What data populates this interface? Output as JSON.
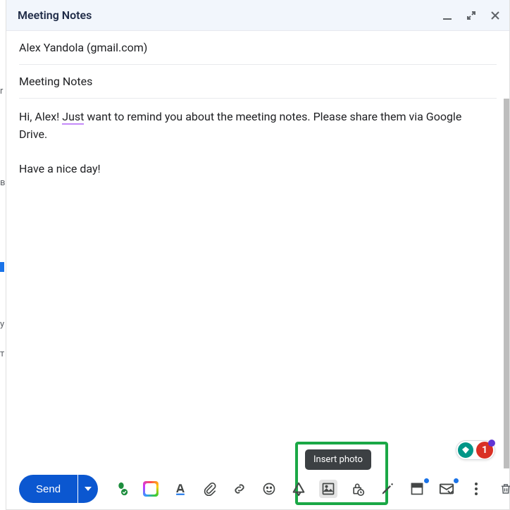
{
  "header": {
    "title": "Meeting Notes"
  },
  "fields": {
    "recipient": "Alex Yandola (gmail.com)",
    "subject": "Meeting Notes"
  },
  "body": {
    "greeting_prefix": "Hi, Alex! ",
    "underlined": "Just",
    "line1_rest": " want to remind you about the meeting notes. Please share them via Google Drive.",
    "line2": "Have a nice day!"
  },
  "toolbar": {
    "send_label": "Send",
    "tooltip": "Insert photo"
  },
  "extension": {
    "count": "1"
  },
  "icons": {
    "minimize": "minimize-icon",
    "expand": "expand-icon",
    "close": "close-icon",
    "send_more": "chevron-down-icon",
    "signature_check": "signature-check-icon",
    "ai_suggest": "ai-suggest-icon",
    "text_format": "text-format-icon",
    "attach": "paperclip-icon",
    "link": "link-icon",
    "emoji": "emoji-icon",
    "drive": "drive-icon",
    "photo": "photo-icon",
    "confidential": "lock-clock-icon",
    "pen": "pen-icon",
    "templates": "templates-icon",
    "followup": "mail-followup-icon",
    "more": "more-vert-icon",
    "trash": "trash-icon"
  }
}
